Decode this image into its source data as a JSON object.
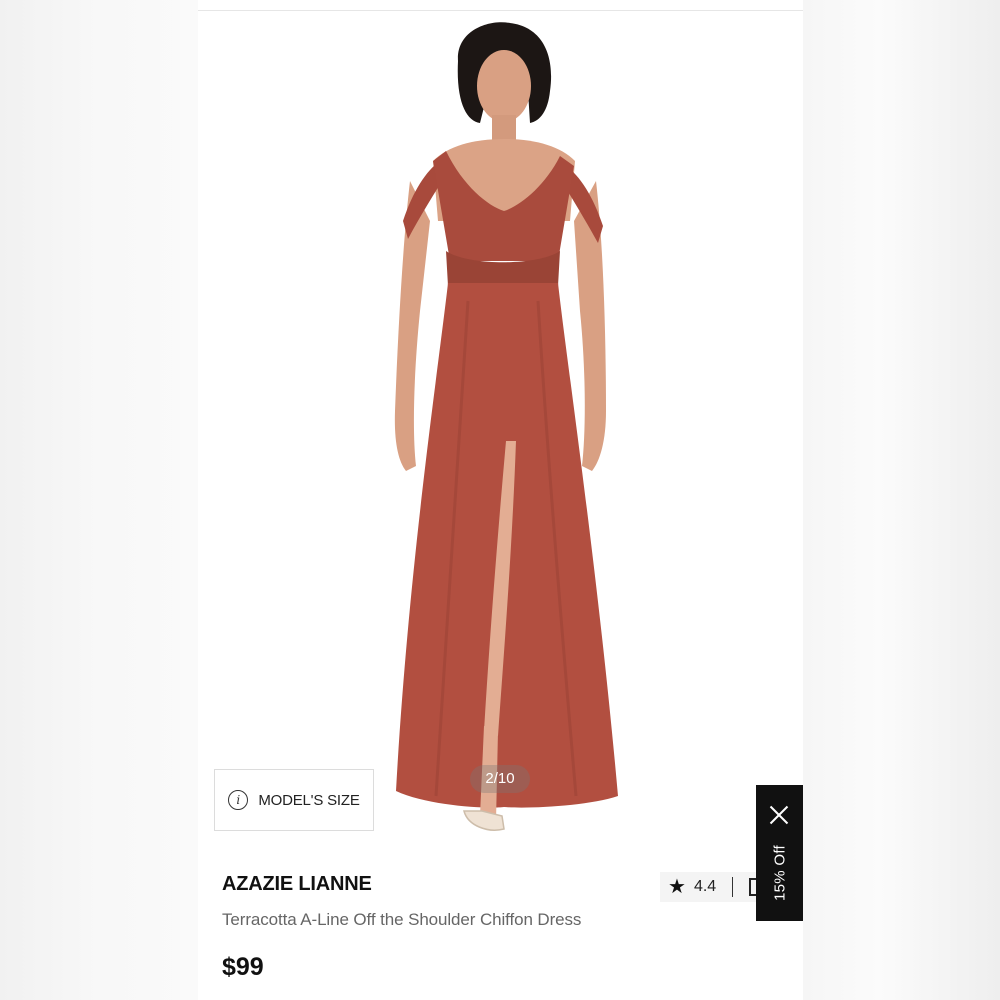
{
  "gallery": {
    "counter": "2/10",
    "model_size_label": "MODEL'S SIZE"
  },
  "product": {
    "brand": "AZAZIE LIANNE",
    "name": "Terracotta A-Line Off the Shoulder Chiffon Dress",
    "price": "$99",
    "rating": "4.4"
  },
  "promo": {
    "label": "15% Off"
  },
  "colors": {
    "dress": "#b24f40",
    "dress_dark": "#8f3c30",
    "skin": "#e0a78c",
    "hair": "#1c1614"
  },
  "icons": [
    "info-icon",
    "star-icon",
    "close-icon",
    "compare-icon"
  ]
}
